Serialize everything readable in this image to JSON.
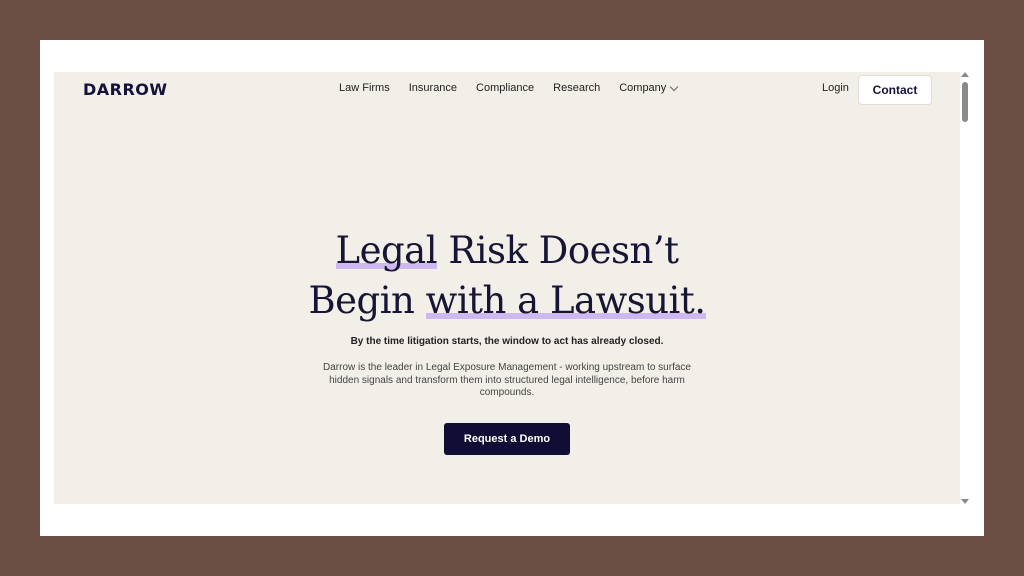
{
  "header": {
    "logo": "DARROW",
    "nav": [
      {
        "label": "Law Firms"
      },
      {
        "label": "Insurance"
      },
      {
        "label": "Compliance"
      },
      {
        "label": "Research"
      },
      {
        "label": "Company"
      }
    ],
    "login_label": "Login",
    "contact_label": "Contact"
  },
  "hero": {
    "title_line1_highlight": "Legal",
    "title_line1_rest": " Risk Doesn’t",
    "title_line2_start": "Begin ",
    "title_line2_highlight": "with a Lawsuit.",
    "subheading": "By the time litigation starts, the window to act has already closed.",
    "description": "Darrow is the leader in Legal Exposure Management - working upstream to surface hidden signals and transform them into structured legal intelligence, before harm compounds.",
    "cta_label": "Request a Demo"
  },
  "colors": {
    "page_bg": "#f2eee8",
    "accent_highlight": "#cdb8f2",
    "primary_dark": "#120d35",
    "outer_bg": "#6b4f45"
  },
  "icons": {
    "company_dropdown": "chevron-down-icon",
    "scroll_up": "arrow-up-icon",
    "scroll_down": "arrow-down-icon"
  }
}
